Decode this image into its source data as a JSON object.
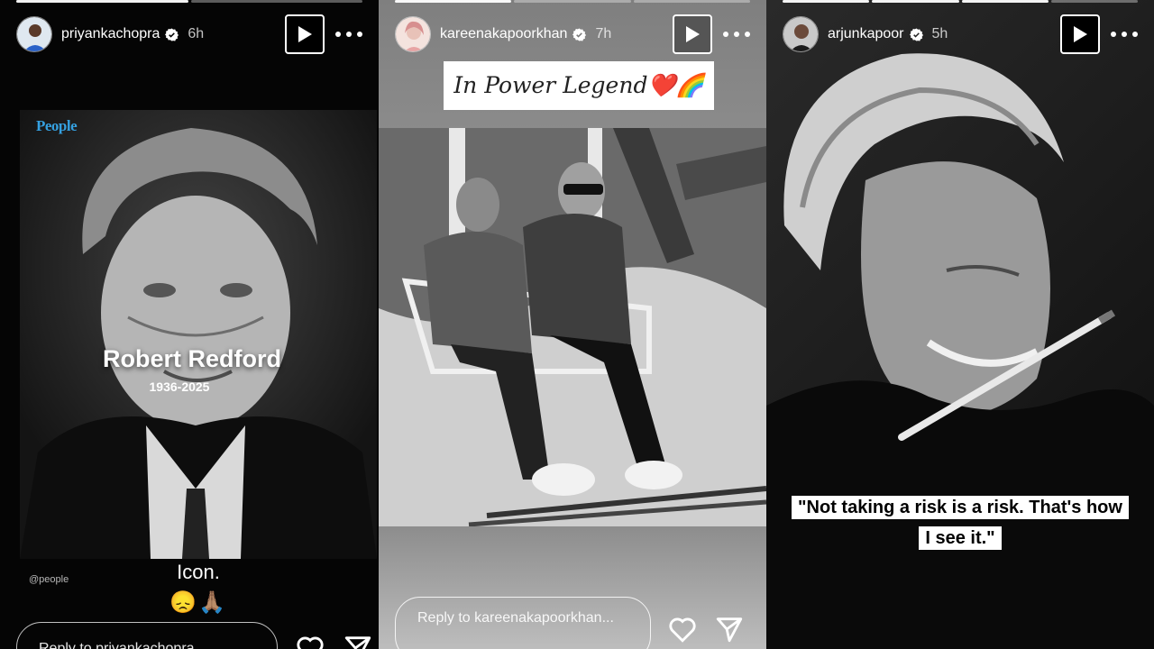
{
  "stories": [
    {
      "username": "priyankachopra",
      "time": "6h",
      "reply_placeholder": "Reply to priyankachopra...",
      "card": {
        "brand": "People",
        "name": "Robert Redford",
        "years": "1936-2025",
        "credit": "@people"
      },
      "caption": "Icon.",
      "emoji": "😞🙏🏽"
    },
    {
      "username": "kareenakapoorkhan",
      "time": "7h",
      "reply_placeholder": "Reply to kareenakapoorkhan...",
      "title_sticker": "In Power Legend❤️🌈"
    },
    {
      "username": "arjunkapoor",
      "time": "5h",
      "quote_line1": "\"Not taking a risk is a risk. That's how",
      "quote_line2": "I see it.\""
    }
  ],
  "colors": {
    "brand_blue": "#35a0e0",
    "verified_blue": "#ffffff",
    "heart_accent": "#e8243c"
  },
  "icons": [
    "verified-icon",
    "play-icon",
    "more-icon",
    "heart-icon",
    "send-icon"
  ]
}
